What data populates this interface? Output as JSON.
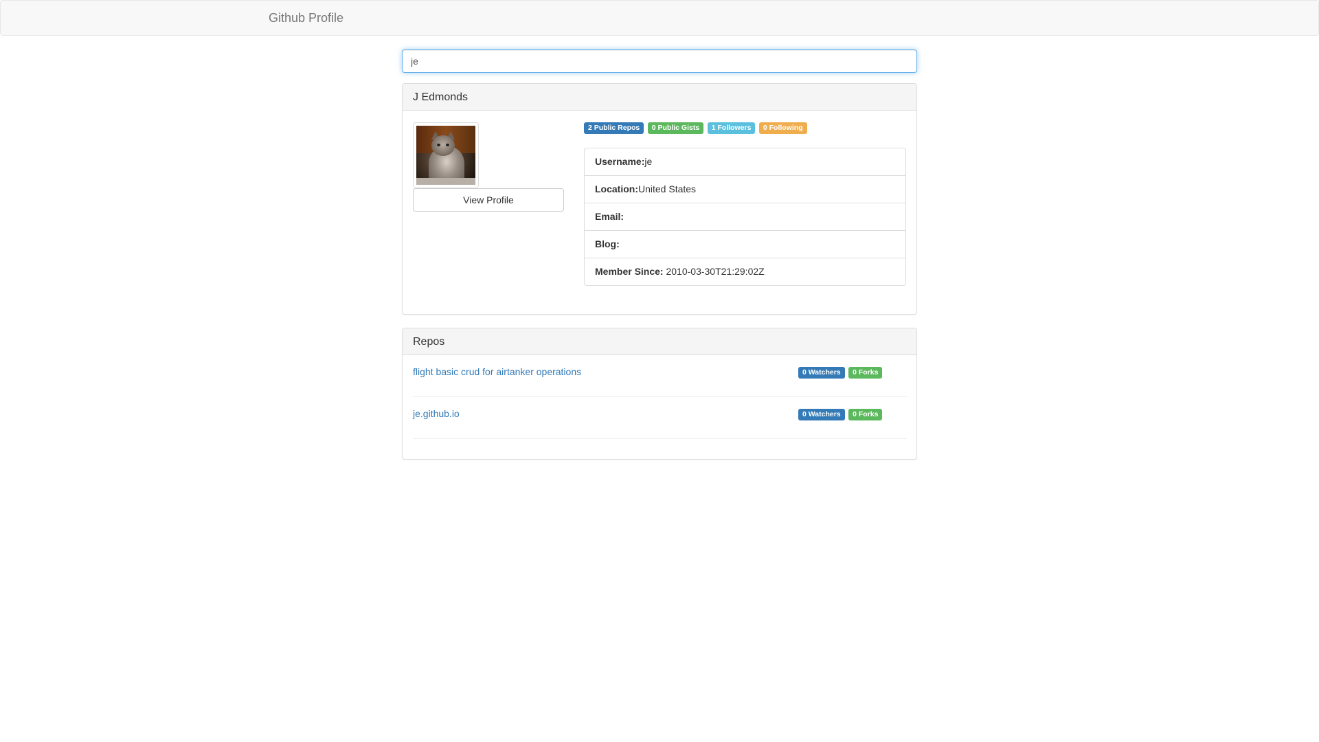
{
  "navbar": {
    "brand": "Github Profile"
  },
  "search": {
    "value": "je",
    "placeholder": ""
  },
  "profile": {
    "name": "J Edmonds",
    "view_profile_label": "View Profile",
    "badges": {
      "public_repos": "2 Public Repos",
      "public_gists": "0 Public Gists",
      "followers": "1 Followers",
      "following": "0 Following"
    },
    "details": {
      "username_label": "Username:",
      "username_value": "je",
      "location_label": "Location:",
      "location_value": "United States",
      "email_label": "Email:",
      "email_value": "",
      "blog_label": "Blog:",
      "blog_value": "",
      "member_since_label": "Member Since:",
      "member_since_value": " 2010-03-30T21:29:02Z"
    }
  },
  "repos": {
    "heading": "Repos",
    "items": [
      {
        "name": "flight basic crud for airtanker operations",
        "watchers": "0 Watchers",
        "forks": "0 Forks"
      },
      {
        "name": "je.github.io",
        "watchers": "0 Watchers",
        "forks": "0 Forks"
      }
    ]
  },
  "colors": {
    "primary": "#337ab7",
    "success": "#5cb85c",
    "info": "#5bc0de",
    "warning": "#f0ad4e"
  },
  "icons": {
    "avatar": "cat-photo-avatar"
  }
}
